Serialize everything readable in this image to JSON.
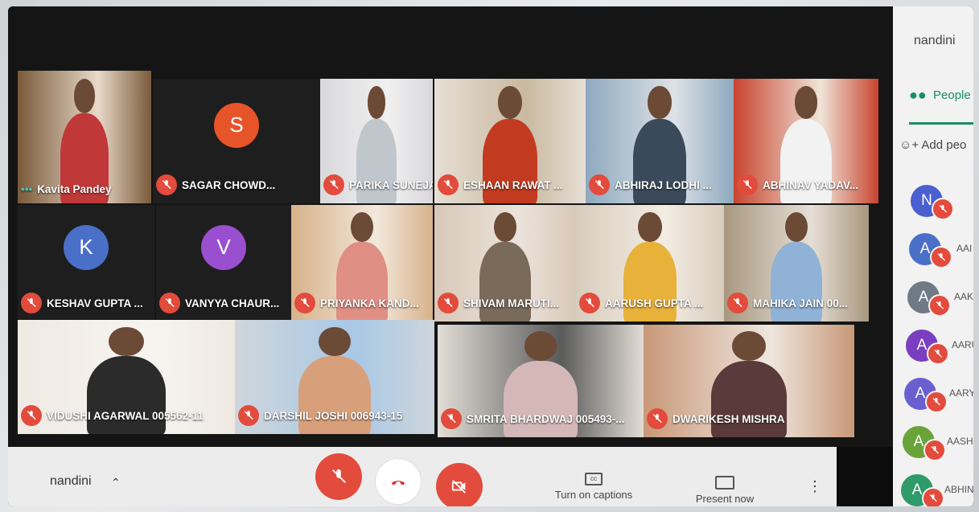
{
  "self_name": "nandini",
  "panel": {
    "tab_people": "People",
    "add_people": "Add peo"
  },
  "tiles": [
    {
      "name": "Kavita Pandey",
      "type": "video",
      "muted": false
    },
    {
      "name": "SAGAR CHOWD...",
      "type": "avatar",
      "initial": "S",
      "color": "#e8542a",
      "muted": true
    },
    {
      "name": "PARIKA SUNEJA ...",
      "type": "video",
      "muted": true
    },
    {
      "name": "ESHAAN RAWAT ...",
      "type": "video",
      "muted": true
    },
    {
      "name": "ABHIRAJ LODHI ...",
      "type": "video",
      "muted": true
    },
    {
      "name": "ABHINAV YADAV...",
      "type": "video",
      "muted": true
    },
    {
      "name": "KESHAV GUPTA ...",
      "type": "avatar",
      "initial": "K",
      "color": "#4a6fc9",
      "muted": true
    },
    {
      "name": "VANYYA CHAUR...",
      "type": "avatar",
      "initial": "V",
      "color": "#9a4fd0",
      "muted": true
    },
    {
      "name": "PRIYANKA KAND...",
      "type": "video",
      "muted": true
    },
    {
      "name": "SHIVAM MARUTI...",
      "type": "video",
      "muted": true
    },
    {
      "name": "AARUSH GUPTA ...",
      "type": "video",
      "muted": true
    },
    {
      "name": "MAHIKA JAIN 00...",
      "type": "video",
      "muted": true
    },
    {
      "name": "VIDUSHI AGARWAL 005562-11",
      "type": "video",
      "muted": true
    },
    {
      "name": "DARSHIL JOSHI 006943-15",
      "type": "video",
      "muted": true
    },
    {
      "name": "SMRITA BHARDWAJ 005493-...",
      "type": "video",
      "muted": true
    },
    {
      "name": "DWARIKESH MISHRA",
      "type": "video",
      "muted": true
    }
  ],
  "participants": [
    {
      "initial": "N",
      "color": "#4a5fd0",
      "name": ""
    },
    {
      "initial": "A",
      "color": "#4a6fc9",
      "name": "AAI"
    },
    {
      "initial": "A",
      "color": "#6f7a86",
      "name": "AAK"
    },
    {
      "initial": "A",
      "color": "#7a3fc0",
      "name": "AARU"
    },
    {
      "initial": "A",
      "color": "#6a5fd0",
      "name": "AARYA"
    },
    {
      "initial": "A",
      "color": "#6aa33a",
      "name": "AASHNA"
    },
    {
      "initial": "A",
      "color": "#2f9a6a",
      "name": "ABHINAV"
    }
  ],
  "controls": {
    "captions": "Turn on captions",
    "present": "Present now"
  }
}
